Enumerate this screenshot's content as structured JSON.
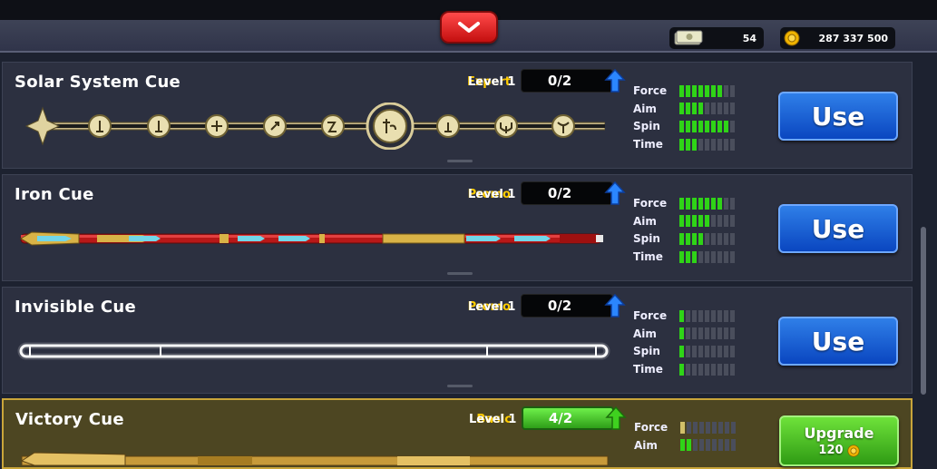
{
  "header": {
    "cash": "54",
    "coins": "287 337 500",
    "cash_icon": "cash-icon",
    "coin_icon": "coin-icon",
    "collapse_icon": "chevron-down-icon"
  },
  "cues": [
    {
      "name": "Solar System Cue",
      "tier": "Expert",
      "level_label": "Level 1",
      "progress": "0/2",
      "stats": {
        "force": 7,
        "aim": 4,
        "spin": 8,
        "time": 3
      },
      "action": "Use",
      "tier_color": "#ffcc00"
    },
    {
      "name": "Iron Cue",
      "tier": "Promo",
      "level_label": "Level 1",
      "progress": "0/2",
      "stats": {
        "force": 7,
        "aim": 5,
        "spin": 4,
        "time": 3
      },
      "action": "Use",
      "tier_color": "#ffcc00"
    },
    {
      "name": "Invisible Cue",
      "tier": "Promo",
      "level_label": "Level 1",
      "progress": "0/2",
      "stats": {
        "force": 1,
        "aim": 1,
        "spin": 1,
        "time": 1
      },
      "action": "Use",
      "tier_color": "#ffcc00"
    },
    {
      "name": "Victory Cue",
      "tier": "Basic",
      "level_label": "Level 1",
      "progress": "4/2",
      "stats": {
        "force": 1,
        "aim": 2
      },
      "action": "Upgrade",
      "cost": "120",
      "tier_color": "#ffcc00"
    }
  ],
  "stat_labels": {
    "force": "Force",
    "aim": "Aim",
    "spin": "Spin",
    "time": "Time"
  },
  "max_bars": 9
}
